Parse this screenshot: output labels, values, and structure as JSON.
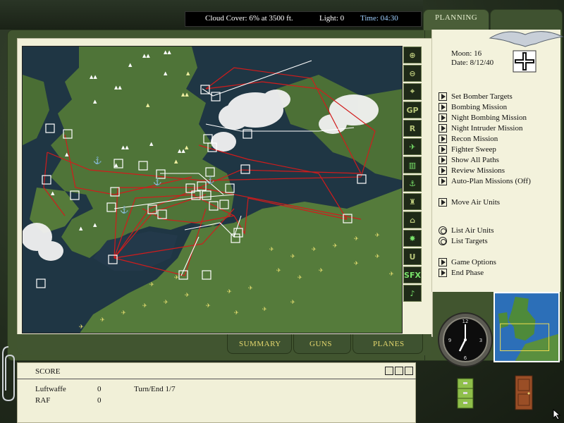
{
  "status": {
    "cloud_cover": "Cloud Cover:  6% at 3500 ft.",
    "light": "Light:  0",
    "time": "Time: 04:30"
  },
  "tabs": {
    "planning": "PLANNING"
  },
  "calendar": {
    "moon": "Moon:  16",
    "date": "Date:  8/12/40"
  },
  "menu": {
    "set_bomber_targets": "Set Bomber Targets",
    "bombing_mission": "Bombing Mission",
    "night_bombing_mission": "Night Bombing Mission",
    "night_intruder_mission": "Night Intruder Mission",
    "recon_mission": "Recon Mission",
    "fighter_sweep": "Fighter Sweep",
    "show_all_paths": "Show All Paths",
    "review_missions": "Review Missions",
    "auto_plan_missions": "Auto-Plan Missions (Off)",
    "move_air_units": "Move Air Units",
    "list_air_units": "List Air Units",
    "list_targets": "List Targets",
    "game_options": "Game Options",
    "end_phase": "End Phase"
  },
  "toolbar": {
    "gp": "GP",
    "r": "R",
    "u": "U",
    "sfx": "SFX"
  },
  "bottom_tabs": {
    "summary": "SUMMARY",
    "guns": "GUNS",
    "planes": "PLANES"
  },
  "score": {
    "title": "SCORE",
    "luftwaffe_label": "Luftwaffe",
    "luftwaffe_value": "0",
    "raf_label": "RAF",
    "raf_value": "0",
    "turn_label": "Turn/End  1/7"
  },
  "colors": {
    "sea": "#1f3644",
    "land": "#4f7438",
    "mission_path_red": "#d11c1c",
    "mission_path_white": "#ffffff",
    "paper": "#f1f0d8",
    "folder_green": "#41552f",
    "time_blue": "#9fd0ff",
    "tab_yellow": "#e5d86e"
  }
}
